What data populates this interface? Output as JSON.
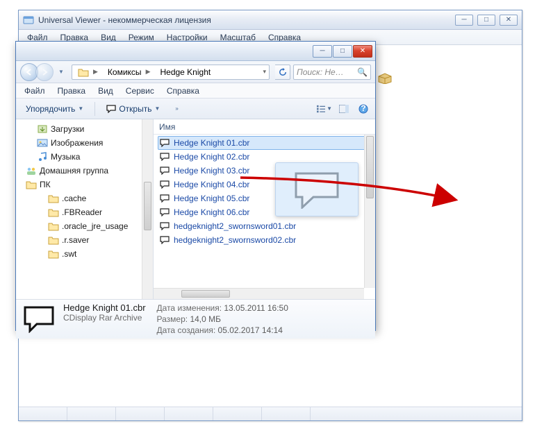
{
  "uv": {
    "title": "Universal Viewer - некоммерческая лицензия",
    "menu": {
      "file": "Файл",
      "edit": "Правка",
      "view": "Вид",
      "mode": "Режим",
      "settings": "Настройки",
      "zoom": "Масштаб",
      "help": "Справка"
    }
  },
  "explorer": {
    "breadcrumb": {
      "seg1": "Комиксы",
      "seg2": "Hedge Knight"
    },
    "search_placeholder": "Поиск: He…",
    "menu": {
      "file": "Файл",
      "edit": "Правка",
      "view": "Вид",
      "service": "Сервис",
      "help": "Справка"
    },
    "toolbar": {
      "organize": "Упорядочить",
      "open": "Открыть"
    },
    "columns": {
      "name": "Имя"
    },
    "tree": {
      "downloads": "Загрузки",
      "pictures": "Изображения",
      "music": "Музыка",
      "homegroup": "Домашняя группа",
      "pc": "ПК",
      "cache": ".cache",
      "fbreader": ".FBReader",
      "oracle": ".oracle_jre_usage",
      "rsaver": ".r.saver",
      "swt": ".swt"
    },
    "files": [
      "Hedge Knight 01.cbr",
      "Hedge Knight 02.cbr",
      "Hedge Knight 03.cbr",
      "Hedge Knight 04.cbr",
      "Hedge Knight 05.cbr",
      "Hedge Knight 06.cbr",
      "hedgeknight2_swornsword01.cbr",
      "hedgeknight2_swornsword02.cbr"
    ],
    "details": {
      "name": "Hedge Knight 01.cbr",
      "type": "CDisplay Rar Archive",
      "modified_label": "Дата изменения:",
      "modified_value": "13.05.2011 16:50",
      "size_label": "Размер:",
      "size_value": "14,0 МБ",
      "created_label": "Дата создания:",
      "created_value": "05.02.2017 14:14"
    }
  }
}
